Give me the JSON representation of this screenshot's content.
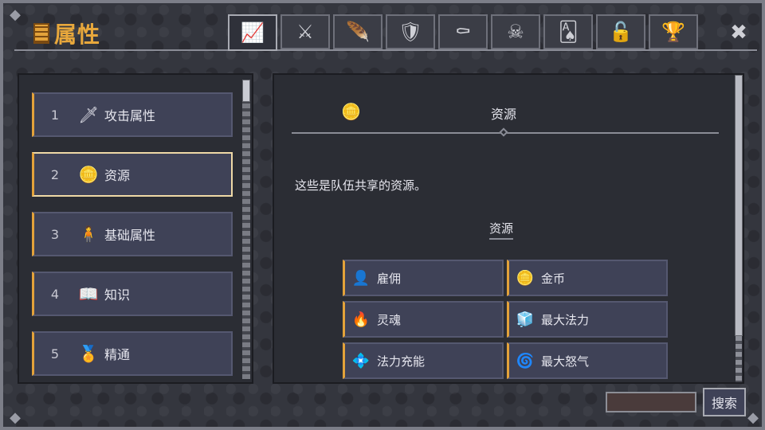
{
  "window": {
    "title": "属性"
  },
  "tabs": [
    {
      "icon": "chart-icon",
      "glyph": "📈",
      "active": true
    },
    {
      "icon": "crossed-swords-icon",
      "glyph": "⚔",
      "active": false
    },
    {
      "icon": "feather-icon",
      "glyph": "🪶",
      "active": false
    },
    {
      "icon": "shield-icon",
      "glyph": "🛡",
      "active": false
    },
    {
      "icon": "tombstone-icon",
      "glyph": "⚰",
      "active": false
    },
    {
      "icon": "skull-icon",
      "glyph": "☠",
      "active": false
    },
    {
      "icon": "cards-icon",
      "glyph": "🂡",
      "active": false
    },
    {
      "icon": "padlock-icon",
      "glyph": "🔓",
      "active": false
    },
    {
      "icon": "trophy-icon",
      "glyph": "🏆",
      "active": false
    }
  ],
  "close_glyph": "✖",
  "categories": [
    {
      "num": "1",
      "icon": "sword-icon",
      "glyph": "🗡",
      "label": "攻击属性",
      "selected": false
    },
    {
      "num": "2",
      "icon": "coins-icon",
      "glyph": "🪙",
      "label": "资源",
      "selected": true
    },
    {
      "num": "3",
      "icon": "figure-icon",
      "glyph": "🧍",
      "label": "基础属性",
      "selected": false
    },
    {
      "num": "4",
      "icon": "book-icon",
      "glyph": "📖",
      "label": "知识",
      "selected": false
    },
    {
      "num": "5",
      "icon": "medal-icon",
      "glyph": "🏅",
      "label": "精通",
      "selected": false
    }
  ],
  "detail": {
    "header_icon": "coins-icon",
    "header_glyph": "🪙",
    "title": "资源",
    "description": "这些是队伍共享的资源。",
    "subheading": "资源",
    "resources": [
      {
        "icon": "person-icon",
        "glyph": "👤",
        "label": "雇佣"
      },
      {
        "icon": "gold-coin-icon",
        "glyph": "🪙",
        "label": "金币"
      },
      {
        "icon": "soul-icon",
        "glyph": "🔥",
        "label": "灵魂"
      },
      {
        "icon": "max-mana-icon",
        "glyph": "🧊",
        "label": "最大法力"
      },
      {
        "icon": "mana-charge-icon",
        "glyph": "💠",
        "label": "法力充能"
      },
      {
        "icon": "rage-icon",
        "glyph": "🌀",
        "label": "最大怒气"
      }
    ]
  },
  "search": {
    "value": "",
    "button_label": "搜索"
  },
  "colors": {
    "accent": "#e3a23a",
    "panel": "#3f4257",
    "background": "#34363e"
  }
}
